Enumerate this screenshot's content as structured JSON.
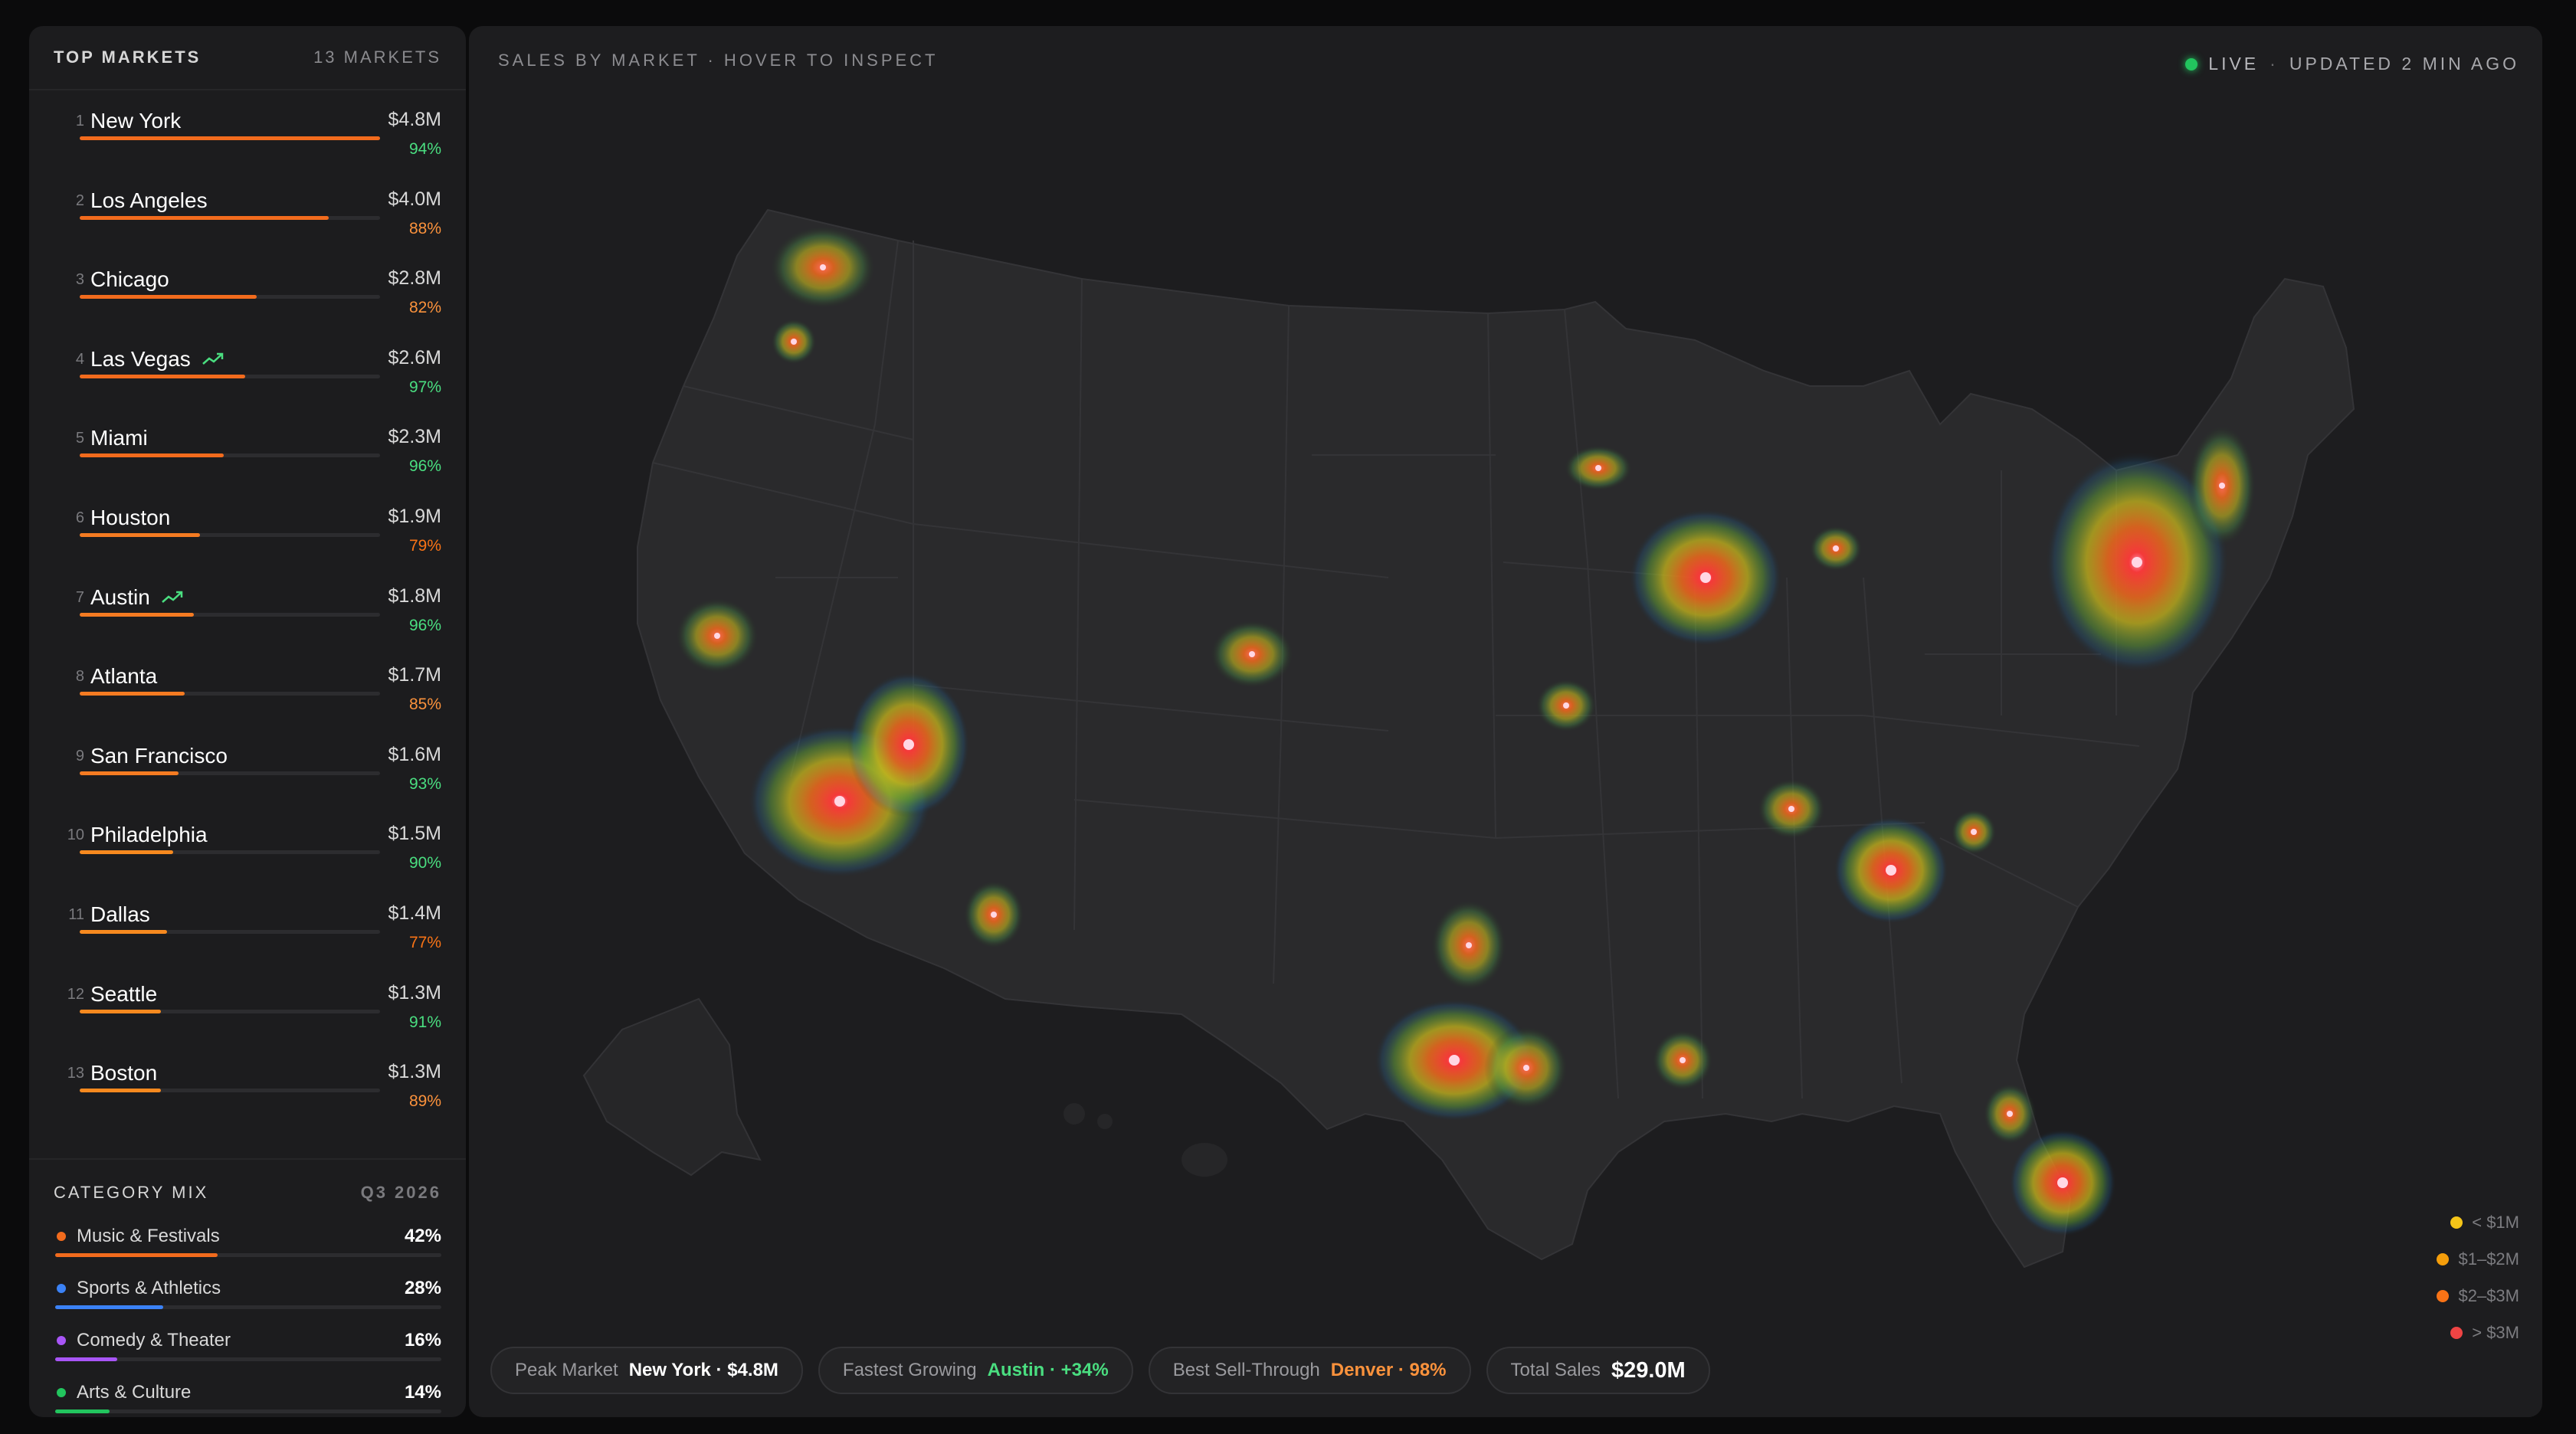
{
  "sidebar": {
    "title": "TOP MARKETS",
    "count_label": "13 MARKETS",
    "markets": [
      {
        "rank": "1",
        "name": "New York",
        "value": "$4.8M",
        "share": 1.0,
        "pct": "94%",
        "pct_color": "#4ade80",
        "bar_color": "#f26b1d",
        "trending": false
      },
      {
        "rank": "2",
        "name": "Los Angeles",
        "value": "$4.0M",
        "share": 0.83,
        "pct": "88%",
        "pct_color": "#fb923c",
        "bar_color": "#f26b1d",
        "trending": false
      },
      {
        "rank": "3",
        "name": "Chicago",
        "value": "$2.8M",
        "share": 0.59,
        "pct": "82%",
        "pct_color": "#fb923c",
        "bar_color": "#f26b1d",
        "trending": false
      },
      {
        "rank": "4",
        "name": "Las Vegas",
        "value": "$2.6M",
        "share": 0.55,
        "pct": "97%",
        "pct_color": "#4ade80",
        "bar_color": "#f26b1d",
        "trending": true
      },
      {
        "rank": "5",
        "name": "Miami",
        "value": "$2.3M",
        "share": 0.48,
        "pct": "96%",
        "pct_color": "#4ade80",
        "bar_color": "#f26b1d",
        "trending": false
      },
      {
        "rank": "6",
        "name": "Houston",
        "value": "$1.9M",
        "share": 0.4,
        "pct": "79%",
        "pct_color": "#f97316",
        "bar_color": "#f47b22",
        "trending": false
      },
      {
        "rank": "7",
        "name": "Austin",
        "value": "$1.8M",
        "share": 0.38,
        "pct": "96%",
        "pct_color": "#4ade80",
        "bar_color": "#f47b22",
        "trending": true
      },
      {
        "rank": "8",
        "name": "Atlanta",
        "value": "$1.7M",
        "share": 0.35,
        "pct": "85%",
        "pct_color": "#fb923c",
        "bar_color": "#f47b22",
        "trending": false
      },
      {
        "rank": "9",
        "name": "San Francisco",
        "value": "$1.6M",
        "share": 0.33,
        "pct": "93%",
        "pct_color": "#4ade80",
        "bar_color": "#f47b22",
        "trending": false
      },
      {
        "rank": "10",
        "name": "Philadelphia",
        "value": "$1.5M",
        "share": 0.31,
        "pct": "90%",
        "pct_color": "#4ade80",
        "bar_color": "#f6891f",
        "trending": false
      },
      {
        "rank": "11",
        "name": "Dallas",
        "value": "$1.4M",
        "share": 0.29,
        "pct": "77%",
        "pct_color": "#f97316",
        "bar_color": "#f6891f",
        "trending": false
      },
      {
        "rank": "12",
        "name": "Seattle",
        "value": "$1.3M",
        "share": 0.27,
        "pct": "91%",
        "pct_color": "#4ade80",
        "bar_color": "#f6891f",
        "trending": false
      },
      {
        "rank": "13",
        "name": "Boston",
        "value": "$1.3M",
        "share": 0.27,
        "pct": "89%",
        "pct_color": "#fb923c",
        "bar_color": "#f6891f",
        "trending": false
      }
    ]
  },
  "categories": {
    "title": "CATEGORY MIX",
    "period": "Q3 2026",
    "items": [
      {
        "label": "Music & Festivals",
        "pct": "42%",
        "share": 0.42,
        "color": "#f26b1d"
      },
      {
        "label": "Sports & Athletics",
        "pct": "28%",
        "share": 0.28,
        "color": "#3b82f6"
      },
      {
        "label": "Comedy & Theater",
        "pct": "16%",
        "share": 0.16,
        "color": "#a855f7"
      },
      {
        "label": "Arts & Culture",
        "pct": "14%",
        "share": 0.14,
        "color": "#22c55e"
      }
    ]
  },
  "map": {
    "title": "SALES BY MARKET · HOVER TO INSPECT",
    "live_label": "LIVE",
    "separator": "·",
    "updated_label": "UPDATED 2 MIN AGO",
    "legend": [
      {
        "label": "< $1M",
        "color": "#f5c518"
      },
      {
        "label": "$1–$2M",
        "color": "#f59e0b"
      },
      {
        "label": "$2–$3M",
        "color": "#f97316"
      },
      {
        "label": "> $3M",
        "color": "#ef4444"
      }
    ]
  },
  "summary": {
    "peak_label": "Peak Market",
    "peak_value": "New York · $4.8M",
    "fastest_label": "Fastest Growing",
    "fastest_value": "Austin · +34%",
    "sell_label": "Best Sell-Through",
    "sell_value": "Denver · 98%",
    "total_label": "Total Sales",
    "total_value": "$29.0M"
  },
  "colors": {
    "accent": "#f26b1d",
    "positive": "#4ade80",
    "fastest": "#4ade80",
    "sell": "#fb923c"
  }
}
